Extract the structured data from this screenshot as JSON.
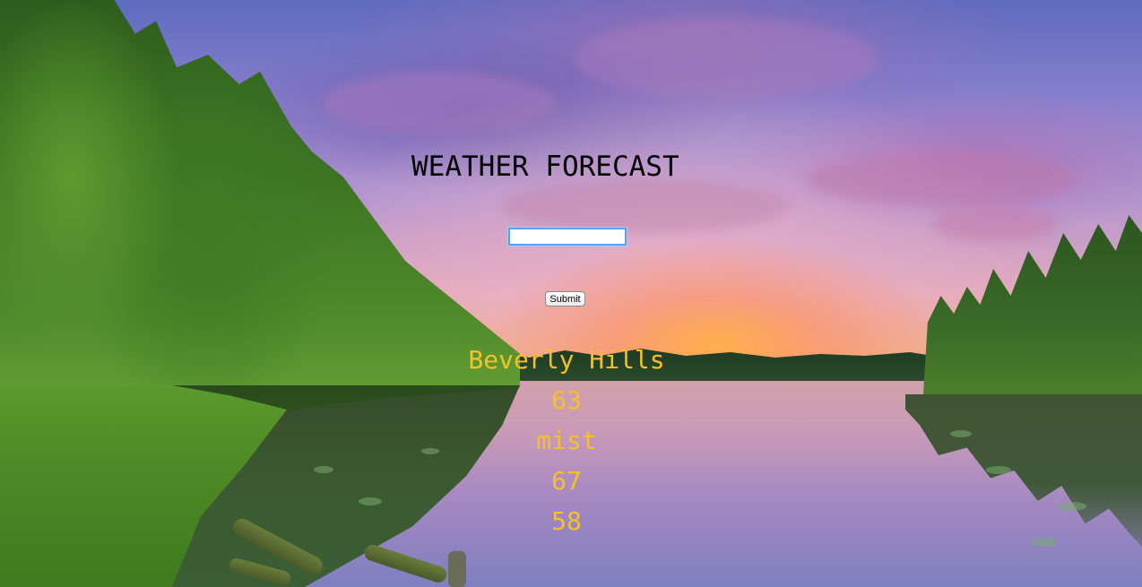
{
  "page": {
    "title": "WEATHER FORECAST"
  },
  "search": {
    "value": "",
    "placeholder": "",
    "submit_label": "Submit"
  },
  "result": {
    "city": "Beverly Hills",
    "temperature": "63",
    "description": "mist",
    "temp_max": "67",
    "temp_min": "58"
  },
  "colors": {
    "title": "#000000",
    "result_text": "#f6c02a",
    "input_focus_border": "#5aa0f0"
  }
}
